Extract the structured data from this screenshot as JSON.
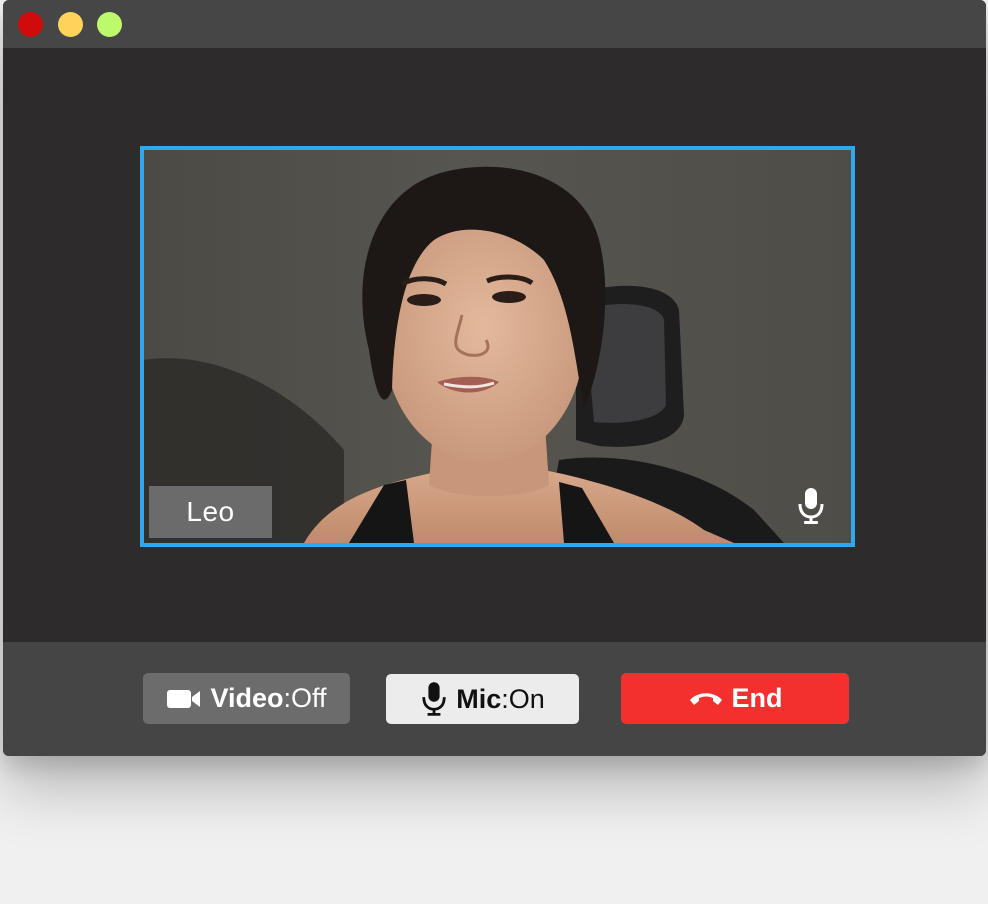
{
  "window": {
    "traffic_lights": [
      "close",
      "minimize",
      "maximize"
    ]
  },
  "participant": {
    "name": "Leo",
    "mic_icon": "microphone-icon",
    "tile_border_color": "#2ea8ee"
  },
  "controls": {
    "video": {
      "icon": "video-camera-icon",
      "label": "Video",
      "separator": ":",
      "state": " Off"
    },
    "mic": {
      "icon": "microphone-icon",
      "label": "Mic",
      "separator": ":",
      "state": " On"
    },
    "end": {
      "icon": "phone-hangup-icon",
      "label": "End",
      "color": "#f4302e"
    }
  }
}
